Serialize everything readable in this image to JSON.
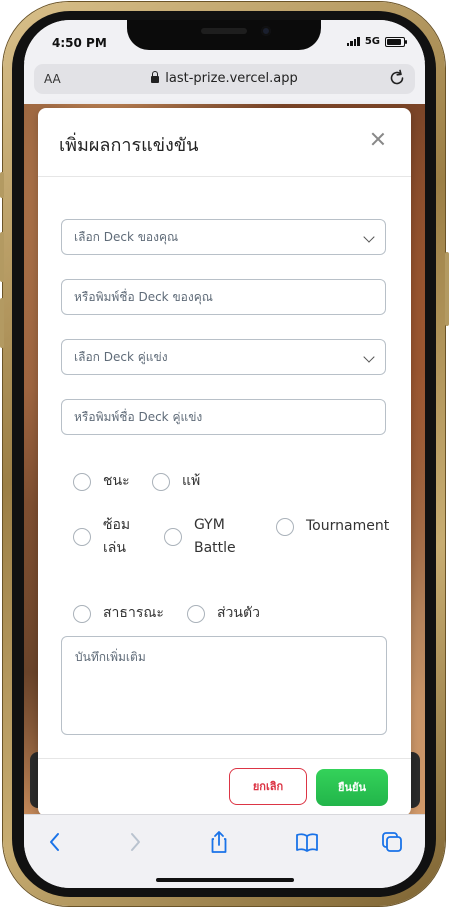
{
  "status_bar": {
    "time": "4:50 PM",
    "network": "5G"
  },
  "browser": {
    "aa_label": "AA",
    "url": "last-prize.vercel.app"
  },
  "modal": {
    "title": "เพิ่มผลการแข่งขัน",
    "my_deck_select": {
      "placeholder": "เลือก Deck ของคุณ"
    },
    "my_deck_input": {
      "placeholder": "หรือพิมพ์ชื่อ Deck ของคุณ"
    },
    "opponent_deck_select": {
      "placeholder": "เลือก Deck คู่แข่ง"
    },
    "opponent_deck_input": {
      "placeholder": "หรือพิมพ์ชื่อ Deck คู่แข่ง"
    },
    "result_options": [
      "ชนะ",
      "แพ้"
    ],
    "match_type_options": [
      {
        "line1": "ซ้อม",
        "line2": "เล่น"
      },
      {
        "line1": "GYM",
        "line2": "Battle"
      },
      {
        "line1": "Tournament",
        "line2": ""
      }
    ],
    "visibility_options": [
      "สาธารณะ",
      "ส่วนตัว"
    ],
    "notes_placeholder": "บันทึกเพิ่มเติม",
    "cancel_label": "ยกเลิก",
    "confirm_label": "ยืนยัน"
  },
  "colors": {
    "danger": "#dc3545",
    "success": "#22b54a",
    "ios_blue": "#1a73e8"
  },
  "toolbar_icons": [
    "back-arrow-icon",
    "forward-arrow-icon",
    "share-icon",
    "bookmarks-icon",
    "tabs-icon"
  ]
}
